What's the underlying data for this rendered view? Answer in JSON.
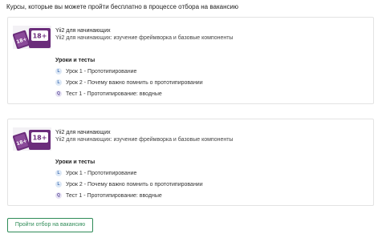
{
  "heading": "Курсы, которые вы можете пройти бесплатно в процессе отбора на вакансию",
  "courses": [
    {
      "thumbnail_icon": "course-thumbnail-icon",
      "badge": "18+",
      "title": "Yii2 для начинающих",
      "description": "Yii2 для начинающих: изучение фреймворка и базовые компоненты",
      "section_title": "Уроки и тесты",
      "items": [
        {
          "type_letter": "L",
          "label": "Урок 1 - Прототипирование"
        },
        {
          "type_letter": "L",
          "label": "Урок 2 - Почему важно помнить о прототипировании"
        },
        {
          "type_letter": "Q",
          "label": "Тест 1 - Прототипирование: вводные"
        }
      ]
    },
    {
      "thumbnail_icon": "course-thumbnail-icon",
      "badge": "18+",
      "title": "Yii2 для начинающих",
      "description": "Yii2 для начинающих: изучение фреймворка и базовые компоненты",
      "section_title": "Уроки и тесты",
      "items": [
        {
          "type_letter": "L",
          "label": "Урок 1 - Прототипирование"
        },
        {
          "type_letter": "L",
          "label": "Урок 2 - Почему важно помнить о прототипировании"
        },
        {
          "type_letter": "Q",
          "label": "Тест 1 - Прототипирование: вводные"
        }
      ]
    }
  ],
  "cta_label": "Пройти отбор на вакансию",
  "colors": {
    "accent": "#2e8b57",
    "thumb_purple": "#6b2d7b",
    "badge_lesson": "#dde8f6",
    "badge_quiz": "#e6e2f3"
  }
}
